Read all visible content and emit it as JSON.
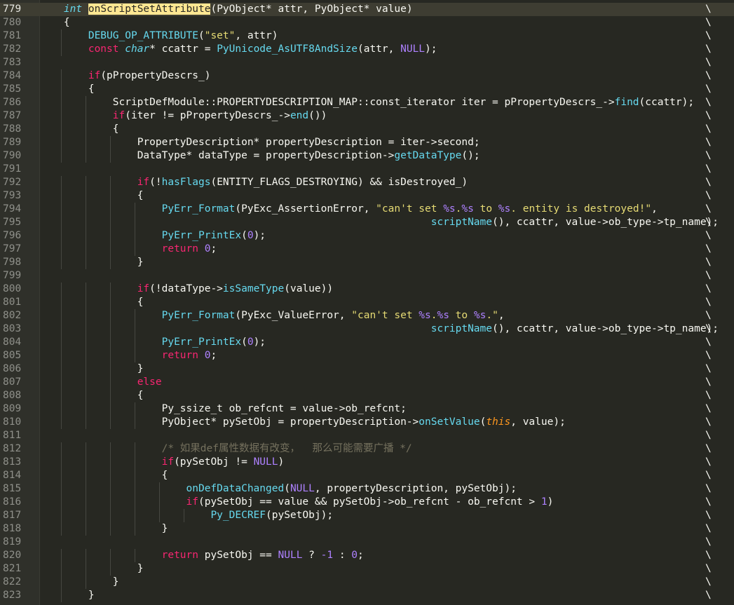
{
  "editor": {
    "active_line": 779,
    "lines": [
      {
        "n": "779",
        "indent": 1,
        "tokens": [
          [
            "ty",
            "int"
          ],
          [
            "pl",
            " "
          ],
          [
            "hl",
            "onScriptSetAttribute"
          ],
          [
            "pl",
            "(PyObject* attr, PyObject* value)"
          ]
        ]
      },
      {
        "n": "780",
        "indent": 1,
        "tokens": [
          [
            "pl",
            "{"
          ]
        ]
      },
      {
        "n": "781",
        "indent": 2,
        "tokens": [
          [
            "fn",
            "DEBUG_OP_ATTRIBUTE"
          ],
          [
            "pl",
            "("
          ],
          [
            "st",
            "\"set\""
          ],
          [
            "pl",
            ", attr)"
          ]
        ]
      },
      {
        "n": "782",
        "indent": 2,
        "tokens": [
          [
            "kw",
            "const"
          ],
          [
            "pl",
            " "
          ],
          [
            "ty",
            "char"
          ],
          [
            "pl",
            "* ccattr = "
          ],
          [
            "fn",
            "PyUnicode_AsUTF8AndSize"
          ],
          [
            "pl",
            "(attr, "
          ],
          [
            "nu",
            "NULL"
          ],
          [
            "pl",
            ");"
          ]
        ]
      },
      {
        "n": "783",
        "indent": 0,
        "tokens": []
      },
      {
        "n": "784",
        "indent": 2,
        "tokens": [
          [
            "kw",
            "if"
          ],
          [
            "pl",
            "(pPropertyDescrs_)"
          ]
        ]
      },
      {
        "n": "785",
        "indent": 2,
        "tokens": [
          [
            "pl",
            "{"
          ]
        ]
      },
      {
        "n": "786",
        "indent": 3,
        "tokens": [
          [
            "pl",
            "ScriptDefModule::PROPERTYDESCRIPTION_MAP::const_iterator iter = pPropertyDescrs_->"
          ],
          [
            "fn",
            "find"
          ],
          [
            "pl",
            "(ccattr);"
          ]
        ]
      },
      {
        "n": "787",
        "indent": 3,
        "tokens": [
          [
            "kw",
            "if"
          ],
          [
            "pl",
            "(iter != pPropertyDescrs_->"
          ],
          [
            "fn",
            "end"
          ],
          [
            "pl",
            "())"
          ]
        ]
      },
      {
        "n": "788",
        "indent": 3,
        "tokens": [
          [
            "pl",
            "{"
          ]
        ]
      },
      {
        "n": "789",
        "indent": 4,
        "tokens": [
          [
            "pl",
            "PropertyDescription* propertyDescription = iter->second;"
          ]
        ]
      },
      {
        "n": "790",
        "indent": 4,
        "tokens": [
          [
            "pl",
            "DataType* dataType = propertyDescription->"
          ],
          [
            "fn",
            "getDataType"
          ],
          [
            "pl",
            "();"
          ]
        ]
      },
      {
        "n": "791",
        "indent": 0,
        "tokens": []
      },
      {
        "n": "792",
        "indent": 4,
        "tokens": [
          [
            "kw",
            "if"
          ],
          [
            "pl",
            "(!"
          ],
          [
            "fn",
            "hasFlags"
          ],
          [
            "pl",
            "(ENTITY_FLAGS_DESTROYING) && isDestroyed_)"
          ]
        ]
      },
      {
        "n": "793",
        "indent": 4,
        "tokens": [
          [
            "pl",
            "{"
          ]
        ]
      },
      {
        "n": "794",
        "indent": 5,
        "tokens": [
          [
            "fn",
            "PyErr_Format"
          ],
          [
            "pl",
            "(PyExc_AssertionError, "
          ],
          [
            "st",
            "\"can't set "
          ],
          [
            "nu",
            "%s"
          ],
          [
            "st",
            "."
          ],
          [
            "nu",
            "%s"
          ],
          [
            "st",
            " to "
          ],
          [
            "nu",
            "%s"
          ],
          [
            "st",
            ". entity is destroyed!\""
          ],
          [
            "pl",
            ","
          ]
        ]
      },
      {
        "n": "795",
        "indent": 0,
        "pad": "                                                                ",
        "tokens": [
          [
            "fn",
            "scriptName"
          ],
          [
            "pl",
            "(), ccattr, value->ob_type->tp_name);"
          ]
        ]
      },
      {
        "n": "796",
        "indent": 5,
        "tokens": [
          [
            "fn",
            "PyErr_PrintEx"
          ],
          [
            "pl",
            "("
          ],
          [
            "nu",
            "0"
          ],
          [
            "pl",
            ");"
          ]
        ]
      },
      {
        "n": "797",
        "indent": 5,
        "tokens": [
          [
            "kw",
            "return"
          ],
          [
            "pl",
            " "
          ],
          [
            "nu",
            "0"
          ],
          [
            "pl",
            ";"
          ]
        ]
      },
      {
        "n": "798",
        "indent": 4,
        "tokens": [
          [
            "pl",
            "}"
          ]
        ]
      },
      {
        "n": "799",
        "indent": 0,
        "tokens": []
      },
      {
        "n": "800",
        "indent": 4,
        "tokens": [
          [
            "kw",
            "if"
          ],
          [
            "pl",
            "(!dataType->"
          ],
          [
            "fn",
            "isSameType"
          ],
          [
            "pl",
            "(value))"
          ]
        ]
      },
      {
        "n": "801",
        "indent": 4,
        "tokens": [
          [
            "pl",
            "{"
          ]
        ]
      },
      {
        "n": "802",
        "indent": 5,
        "tokens": [
          [
            "fn",
            "PyErr_Format"
          ],
          [
            "pl",
            "(PyExc_ValueError, "
          ],
          [
            "st",
            "\"can't set "
          ],
          [
            "nu",
            "%s"
          ],
          [
            "st",
            "."
          ],
          [
            "nu",
            "%s"
          ],
          [
            "st",
            " to "
          ],
          [
            "nu",
            "%s"
          ],
          [
            "st",
            ".\""
          ],
          [
            "pl",
            ","
          ]
        ]
      },
      {
        "n": "803",
        "indent": 0,
        "pad": "                                                                ",
        "tokens": [
          [
            "fn",
            "scriptName"
          ],
          [
            "pl",
            "(), ccattr, value->ob_type->tp_name);"
          ]
        ]
      },
      {
        "n": "804",
        "indent": 5,
        "tokens": [
          [
            "fn",
            "PyErr_PrintEx"
          ],
          [
            "pl",
            "("
          ],
          [
            "nu",
            "0"
          ],
          [
            "pl",
            ");"
          ]
        ]
      },
      {
        "n": "805",
        "indent": 5,
        "tokens": [
          [
            "kw",
            "return"
          ],
          [
            "pl",
            " "
          ],
          [
            "nu",
            "0"
          ],
          [
            "pl",
            ";"
          ]
        ]
      },
      {
        "n": "806",
        "indent": 4,
        "tokens": [
          [
            "pl",
            "}"
          ]
        ]
      },
      {
        "n": "807",
        "indent": 4,
        "tokens": [
          [
            "kw",
            "else"
          ]
        ]
      },
      {
        "n": "808",
        "indent": 4,
        "tokens": [
          [
            "pl",
            "{"
          ]
        ]
      },
      {
        "n": "809",
        "indent": 5,
        "tokens": [
          [
            "pl",
            "Py_ssize_t ob_refcnt = value->ob_refcnt;"
          ]
        ]
      },
      {
        "n": "810",
        "indent": 5,
        "tokens": [
          [
            "pl",
            "PyObject* pySetObj = propertyDescription->"
          ],
          [
            "fn",
            "onSetValue"
          ],
          [
            "pl",
            "("
          ],
          [
            "th",
            "this"
          ],
          [
            "pl",
            ", value);"
          ]
        ]
      },
      {
        "n": "811",
        "indent": 0,
        "tokens": []
      },
      {
        "n": "812",
        "indent": 5,
        "tokens": [
          [
            "co",
            "/* 如果def属性数据有改变，  那么可能需要广播 */"
          ]
        ]
      },
      {
        "n": "813",
        "indent": 5,
        "tokens": [
          [
            "kw",
            "if"
          ],
          [
            "pl",
            "(pySetObj != "
          ],
          [
            "nu",
            "NULL"
          ],
          [
            "pl",
            ")"
          ]
        ]
      },
      {
        "n": "814",
        "indent": 5,
        "tokens": [
          [
            "pl",
            "{"
          ]
        ]
      },
      {
        "n": "815",
        "indent": 6,
        "tokens": [
          [
            "fn",
            "onDefDataChanged"
          ],
          [
            "pl",
            "("
          ],
          [
            "nu",
            "NULL"
          ],
          [
            "pl",
            ", propertyDescription, pySetObj);"
          ]
        ]
      },
      {
        "n": "816",
        "indent": 6,
        "tokens": [
          [
            "kw",
            "if"
          ],
          [
            "pl",
            "(pySetObj == value && pySetObj->ob_refcnt - ob_refcnt > "
          ],
          [
            "nu",
            "1"
          ],
          [
            "pl",
            ")"
          ]
        ]
      },
      {
        "n": "817",
        "indent": 7,
        "tokens": [
          [
            "fn",
            "Py_DECREF"
          ],
          [
            "pl",
            "(pySetObj);"
          ]
        ]
      },
      {
        "n": "818",
        "indent": 5,
        "tokens": [
          [
            "pl",
            "}"
          ]
        ]
      },
      {
        "n": "819",
        "indent": 0,
        "tokens": []
      },
      {
        "n": "820",
        "indent": 5,
        "tokens": [
          [
            "kw",
            "return"
          ],
          [
            "pl",
            " pySetObj == "
          ],
          [
            "nu",
            "NULL"
          ],
          [
            "pl",
            " ? "
          ],
          [
            "nu",
            "-1"
          ],
          [
            "pl",
            " : "
          ],
          [
            "nu",
            "0"
          ],
          [
            "pl",
            ";"
          ]
        ]
      },
      {
        "n": "821",
        "indent": 4,
        "tokens": [
          [
            "pl",
            "}"
          ]
        ]
      },
      {
        "n": "822",
        "indent": 3,
        "tokens": [
          [
            "pl",
            "}"
          ]
        ]
      },
      {
        "n": "823",
        "indent": 2,
        "tokens": [
          [
            "pl",
            "}"
          ]
        ]
      }
    ],
    "continuation_char": "\\",
    "colors": {
      "background": "#272822",
      "keyword": "#f92672",
      "type": "#66d9ef",
      "string": "#e6db74",
      "number": "#ae81ff",
      "comment": "#75715e",
      "highlight": "#ffe792"
    }
  }
}
